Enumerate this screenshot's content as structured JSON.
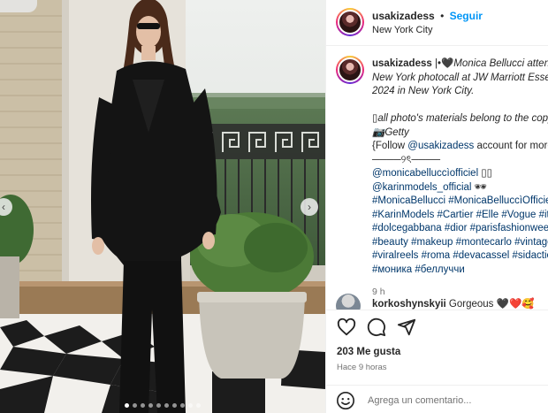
{
  "post": {
    "header": {
      "username": "usakizadess",
      "separator": "•",
      "follow_label": "Seguir",
      "location": "New York City"
    },
    "caption": {
      "username": "usakizadess",
      "line1_rest": " |•🖤",
      "line1_italic": "Monica Bellucci attends the",
      "line2": "New York photocall at JW Marriott Essex House",
      "line3": "2024 in New York City.",
      "line4": "▯all photo's materials belong to the copyright",
      "line5": "📷Getty",
      "line6_pre": "{Follow ",
      "line6_tag": "@usakizadess",
      "line6_post": " account for more!}",
      "line7": "────୨ৎ────",
      "line8_tag": "@monicabelluccìofficiel",
      "line8_post": " ▯▯",
      "line9_tag": "@karinmodels_official",
      "line9_post": " 🕶",
      "line10": "#MonicaBellucci #MonicaBelluccìOfficiel",
      "line11": "#KarinModels #Cartier #Elle #Vogue #italy",
      "line12": "#dolcegabbana #dior #parisfashionweek",
      "line13": "#beauty #makeup #montecarlo #vintage",
      "line14": "#viralreels #roma #devacassel #sidactions",
      "line15": "#моника #беллуччи",
      "time": "9 h"
    },
    "comment": {
      "username": "korkoshynskyii",
      "text": " Gorgeous 🖤❤️🥰"
    },
    "likes": "203 Me gusta",
    "posted": "Hace 9 horas",
    "add_comment_placeholder": "Agrega un comentario..."
  },
  "carousel": {
    "dot_count": 10,
    "active_index": 0
  },
  "icons": [
    "heart-icon",
    "comment-icon",
    "share-icon",
    "emoji-icon",
    "chevron-left-icon",
    "chevron-right-icon"
  ],
  "colors": {
    "accent": "#0095f6",
    "hashtag": "#00376b",
    "muted": "#737373"
  }
}
